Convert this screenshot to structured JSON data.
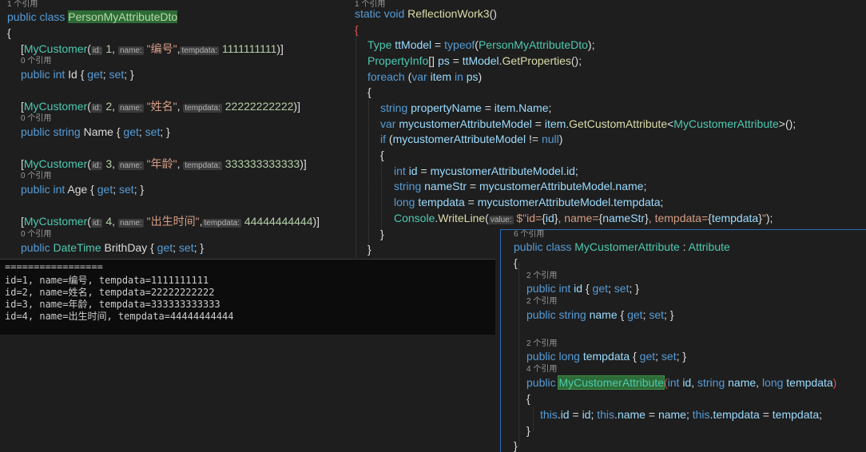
{
  "left": {
    "lens_top": "1 个引用",
    "class_line": {
      "prefix": "public class ",
      "name": "PersonMyAttributeDto"
    },
    "open_brace": "{",
    "props": [
      {
        "attr": "MyCustomer",
        "id_hint": "id:",
        "id_val": "1",
        "name_hint": "name:",
        "name_val": "\"编号\"",
        "temp_hint": "tempdata:",
        "temp_val": "1111111111",
        "lens": "0 个引用",
        "decl_pre": "public ",
        "decl_type": "int",
        "decl_name": " Id { ",
        "get": "get",
        "set": "set",
        "decl_end": "; }"
      },
      {
        "attr": "MyCustomer",
        "id_hint": "id:",
        "id_val": "2",
        "name_hint": "name:",
        "name_val": "\"姓名\"",
        "temp_hint": "tempdata:",
        "temp_val": "22222222222",
        "lens": "0 个引用",
        "decl_pre": "public ",
        "decl_type": "string",
        "decl_name": " Name { ",
        "get": "get",
        "set": "set",
        "decl_end": "; }"
      },
      {
        "attr": "MyCustomer",
        "id_hint": "id:",
        "id_val": "3",
        "name_hint": "name:",
        "name_val": "\"年龄\"",
        "temp_hint": "tempdata:",
        "temp_val": "333333333333",
        "lens": "0 个引用",
        "decl_pre": "public ",
        "decl_type": "int",
        "decl_name": " Age { ",
        "get": "get",
        "set": "set",
        "decl_end": "; }"
      },
      {
        "attr": "MyCustomer",
        "id_hint": "id:",
        "id_val": "4",
        "name_hint": "name:",
        "name_val": "\"出生时间\"",
        "temp_hint": "tempdata:",
        "temp_val": "44444444444",
        "lens": "0 个引用",
        "decl_pre": "public ",
        "decl_type": "DateTime",
        "decl_name": " BrithDay { ",
        "get": "get",
        "set": "set",
        "decl_end": "; }"
      }
    ]
  },
  "right": {
    "lens_top": "1 个引用",
    "method": "static void ReflectionWork3()",
    "open_brace": "{",
    "lines": [
      "Type ttModel = typeof(PersonMyAttributeDto);",
      "PropertyInfo[] ps = ttModel.GetProperties();",
      "foreach (var item in ps)",
      "{",
      "string propertyName = item.Name;",
      "var mycustomerAttributeModel = item.GetCustomAttribute<MyCustomerAttribute>();",
      "if (mycustomerAttributeModel != null)",
      "{",
      "int id = mycustomerAttributeModel.id;",
      "string nameStr = mycustomerAttributeModel.name;",
      "long tempdata = mycustomerAttributeModel.tempdata;",
      "Console.WriteLine(",
      "value:",
      " $\"id={id}, name={nameStr}, tempdata={tempdata}\");",
      "}",
      "}"
    ]
  },
  "console": {
    "separator": "=================",
    "outputs": [
      "id=1, name=编号, tempdata=1111111111",
      "id=2, name=姓名, tempdata=22222222222",
      "id=3, name=年龄, tempdata=333333333333",
      "id=4, name=出生时间, tempdata=44444444444"
    ]
  },
  "popup": {
    "lens_top": "6 个引用",
    "class_line": "public class MyCustomerAttribute : Attribute",
    "open_brace": "{",
    "lens1": "2 个引用",
    "prop1": "public int id { get; set; }",
    "lens2": "2 个引用",
    "prop2": "public string name { get; set; }",
    "lens3": "2 个引用",
    "prop3": "public long tempdata { get; set; }",
    "lens4": "4 个引用",
    "ctor_name": "MyCustomerAttribute",
    "ctor_params": "(int id, string name, long tempdata)",
    "ctor_open": "{",
    "ctor_body": "this.id = id; this.name = name; this.tempdata = tempdata;",
    "ctor_close": "}",
    "close_brace": "}"
  }
}
